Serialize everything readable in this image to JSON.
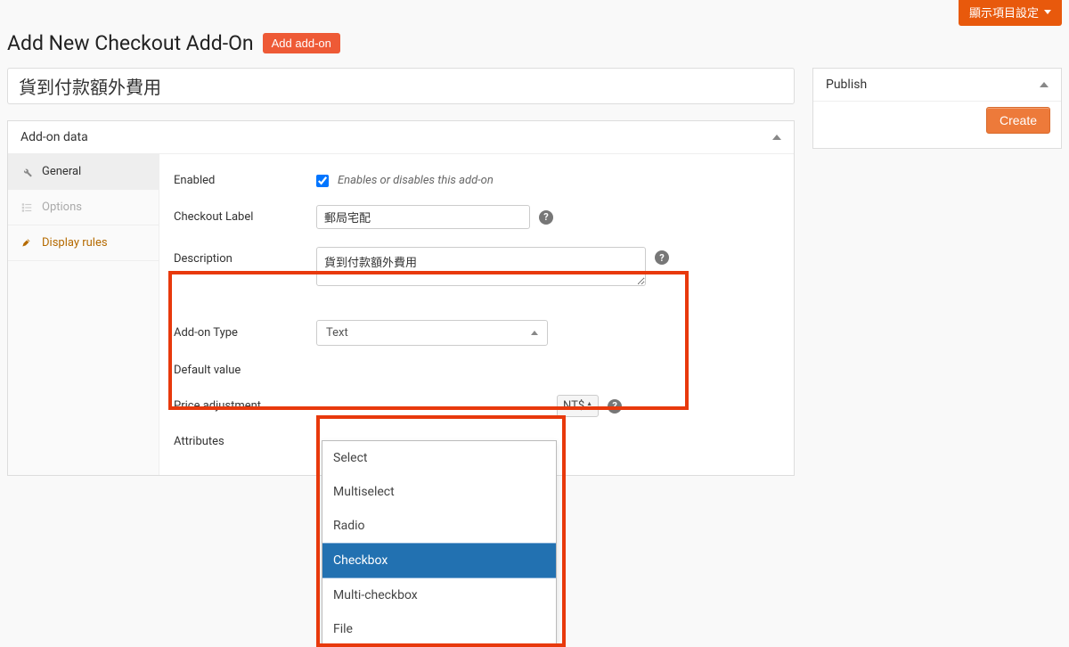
{
  "screen_options_label": "顯示項目設定",
  "page_title": "Add New Checkout Add-On",
  "add_addon_button": "Add add-on",
  "title_value": "貨到付款額外費用",
  "addon_data_heading": "Add-on data",
  "tabs": {
    "general": "General",
    "options": "Options",
    "display_rules": "Display rules"
  },
  "fields": {
    "enabled_label": "Enabled",
    "enabled_checked": true,
    "enabled_hint": "Enables or disables this add-on",
    "checkout_label_label": "Checkout Label",
    "checkout_label_value": "郵局宅配",
    "description_label": "Description",
    "description_value": "貨到付款額外費用",
    "addon_type_label": "Add-on Type",
    "addon_type_selected": "Text",
    "default_value_label": "Default value",
    "price_adjustment_label": "Price adjustment",
    "price_currency": "NT$",
    "attributes_label": "Attributes"
  },
  "type_options": [
    "Select",
    "Multiselect",
    "Radio",
    "Checkbox",
    "Multi-checkbox",
    "File"
  ],
  "type_highlight_index": 3,
  "publish": {
    "heading": "Publish",
    "create_button": "Create"
  }
}
